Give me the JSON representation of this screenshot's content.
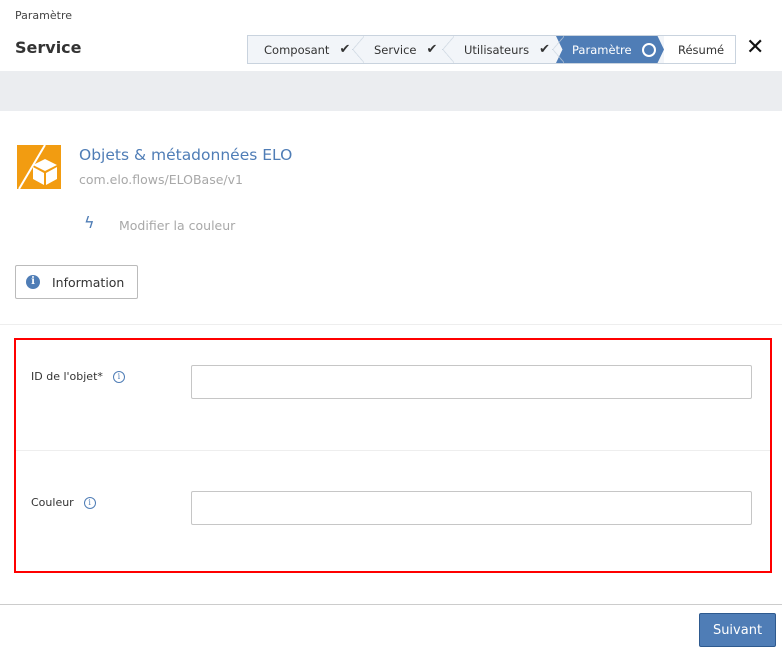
{
  "header": {
    "breadcrumb": "Paramètre",
    "title": "Service",
    "close_icon": "close-icon"
  },
  "stepper": {
    "steps": [
      {
        "label": "Composant",
        "state": "done"
      },
      {
        "label": "Service",
        "state": "done"
      },
      {
        "label": "Utilisateurs",
        "state": "done"
      },
      {
        "label": "Paramètre",
        "state": "active"
      },
      {
        "label": "Résumé",
        "state": "pending"
      }
    ],
    "active_color": "#4f7db6"
  },
  "service": {
    "name": "Objets & métadonnées ELO",
    "id": "com.elo.flows/ELOBase/v1",
    "logo_color": "#f29c11",
    "change_color": "Modifier la couleur"
  },
  "info_button": "Information",
  "form": {
    "fields": [
      {
        "label": "ID de l'objet*",
        "value": "",
        "required": true
      },
      {
        "label": "Couleur",
        "value": ""
      }
    ]
  },
  "footer": {
    "next": "Suivant"
  }
}
